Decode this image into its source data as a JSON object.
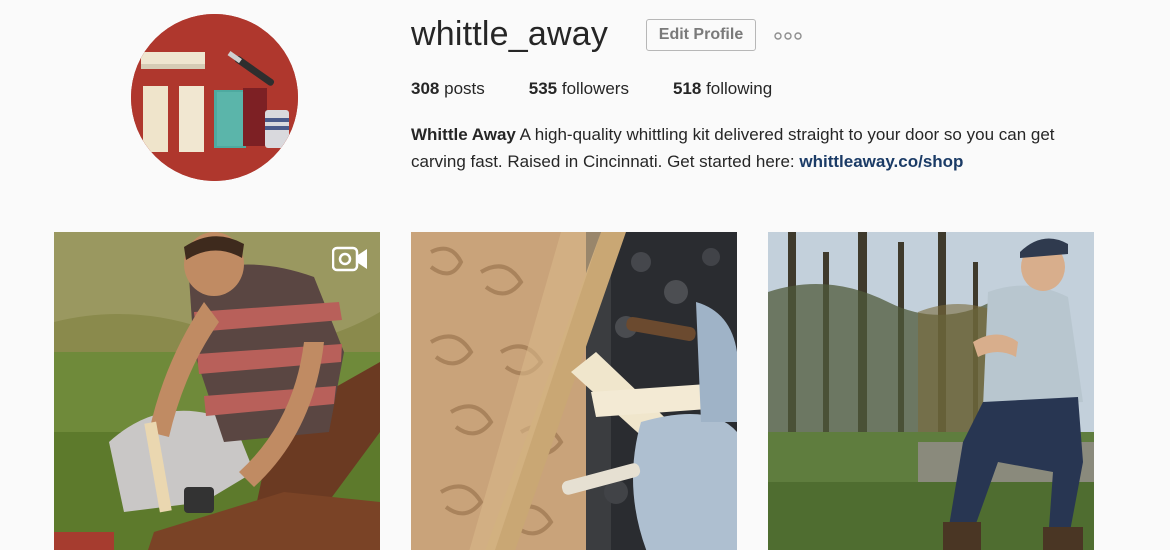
{
  "profile": {
    "username": "whittle_away",
    "edit_label": "Edit Profile",
    "more_icon": "more-dots-icon"
  },
  "stats": {
    "posts_count": "308",
    "posts_label": "posts",
    "followers_count": "535",
    "followers_label": "followers",
    "following_count": "518",
    "following_label": "following"
  },
  "bio": {
    "name": "Whittle Away",
    "text": "A high-quality whittling kit delivered straight to your door so you can get carving fast. Raised in Cincinnati. Get started here:",
    "link": "whittleaway.co/shop"
  },
  "posts": [
    {
      "kind": "video",
      "icon": "video-camera-icon"
    },
    {
      "kind": "photo"
    },
    {
      "kind": "photo"
    }
  ],
  "colors": {
    "background": "#fafafa",
    "text": "#262626",
    "link": "#1b3b66",
    "button_border": "#b7b7b7"
  }
}
